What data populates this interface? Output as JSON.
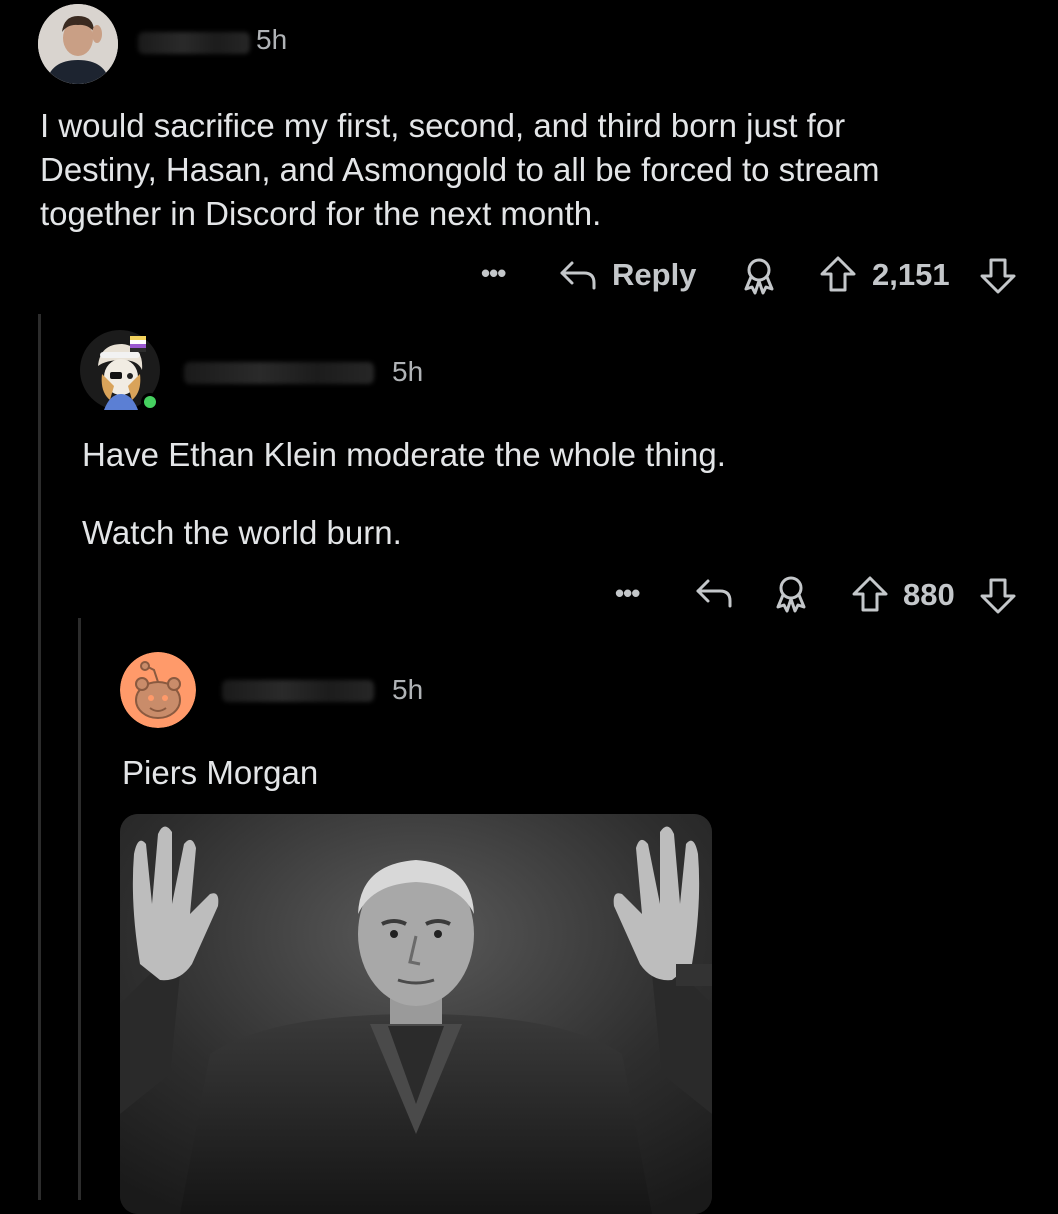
{
  "colors": {
    "background": "#000000",
    "text": "#e3e5e7",
    "muted": "#b0b3b6",
    "thread_line": "#2c2c2c",
    "online": "#46d160",
    "snoo_bg": "#ff9a6a"
  },
  "comments": [
    {
      "time": "5h",
      "body": "I would sacrifice my first, second, and third born just for\nDestiny, Hasan, and Asmongold to all be forced to stream\ntogether in Discord for the next month.",
      "actions": {
        "more": "•••",
        "reply_label": "Reply",
        "score": "2,151"
      },
      "icons": [
        "more-icon",
        "reply-icon",
        "award-icon",
        "upvote-icon",
        "downvote-icon"
      ]
    },
    {
      "time": "5h",
      "body_lines": [
        "Have Ethan Klein moderate the whole thing.",
        "Watch the world burn."
      ],
      "actions": {
        "more": "•••",
        "score": "880"
      },
      "icons": [
        "more-icon",
        "reply-icon",
        "award-icon",
        "upvote-icon",
        "downvote-icon"
      ]
    },
    {
      "time": "5h",
      "body": "Piers Morgan",
      "media": "photo-image"
    }
  ]
}
